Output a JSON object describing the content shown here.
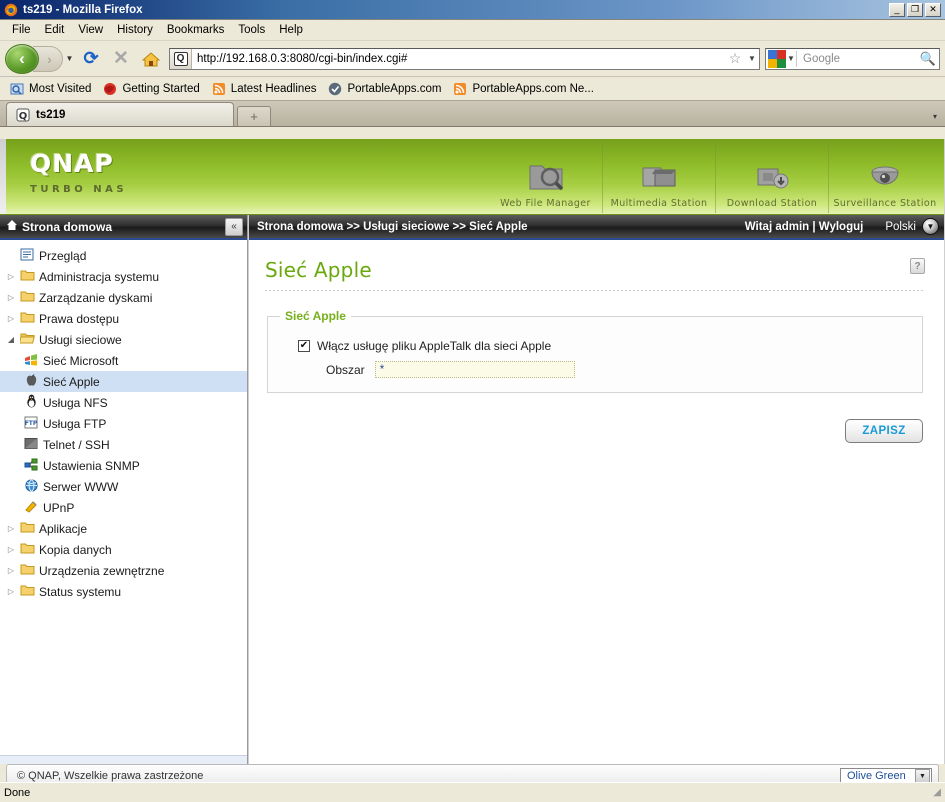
{
  "window": {
    "title": "ts219 - Mozilla Firefox",
    "icon": "firefox-icon",
    "minimize": "_",
    "maximize": "❐",
    "close": "✕"
  },
  "menubar": {
    "items": [
      {
        "label": "File"
      },
      {
        "label": "Edit"
      },
      {
        "label": "View"
      },
      {
        "label": "History"
      },
      {
        "label": "Bookmarks"
      },
      {
        "label": "Tools"
      },
      {
        "label": "Help"
      }
    ]
  },
  "toolbar": {
    "back": "‹",
    "forward": "›",
    "history_caret": "▼",
    "reload": "⟳",
    "stop": "✕",
    "home": "home-icon",
    "url": "http://192.168.0.3:8080/cgi-bin/index.cgi#",
    "url_favicon": "Q",
    "bookmark_star": "☆",
    "url_caret": "▼",
    "search_placeholder": "Google",
    "search_engine": "google-icon",
    "search_caret": "▼",
    "search_magnifier": "🔍"
  },
  "bookmarks": {
    "items": [
      {
        "label": "Most Visited",
        "icon": "most-visited-icon"
      },
      {
        "label": "Getting Started",
        "icon": "firefox-icon"
      },
      {
        "label": "Latest Headlines",
        "icon": "rss-icon"
      },
      {
        "label": "PortableApps.com",
        "icon": "portableapps-icon"
      },
      {
        "label": "PortableApps.com Ne...",
        "icon": "rss-icon"
      }
    ]
  },
  "tabs": {
    "active": {
      "label": "ts219",
      "icon": "qnap-favicon"
    },
    "new_tab": "+",
    "list_all": "▾"
  },
  "banner": {
    "brand": "QNAP",
    "tagline": "TURBO NAS",
    "stations": [
      {
        "label": "Web File Manager",
        "icon": "folder-search-icon"
      },
      {
        "label": "Multimedia Station",
        "icon": "clapperboard-icon"
      },
      {
        "label": "Download Station",
        "icon": "download-box-icon"
      },
      {
        "label": "Surveillance Station",
        "icon": "dome-camera-icon"
      }
    ]
  },
  "sidebar": {
    "header": {
      "title": "Strona domowa",
      "icon": "home-icon",
      "collapse": "«"
    },
    "items": [
      {
        "label": "Przegląd",
        "icon": "overview-icon",
        "level": 1,
        "arrow": "",
        "selected": false
      },
      {
        "label": "Administracja systemu",
        "icon": "folder-icon",
        "level": 1,
        "arrow": "▷",
        "selected": false
      },
      {
        "label": "Zarządzanie dyskami",
        "icon": "folder-icon",
        "level": 1,
        "arrow": "▷",
        "selected": false
      },
      {
        "label": "Prawa dostępu",
        "icon": "folder-icon",
        "level": 1,
        "arrow": "▷",
        "selected": false
      },
      {
        "label": "Usługi sieciowe",
        "icon": "folder-open-icon",
        "level": 1,
        "arrow": "◢",
        "selected": false
      },
      {
        "label": "Sieć Microsoft",
        "icon": "windows-icon",
        "level": 2,
        "arrow": "",
        "selected": false
      },
      {
        "label": "Sieć Apple",
        "icon": "apple-icon",
        "level": 2,
        "arrow": "",
        "selected": true
      },
      {
        "label": "Usługa NFS",
        "icon": "linux-penguin-icon",
        "level": 2,
        "arrow": "",
        "selected": false
      },
      {
        "label": "Usługa FTP",
        "icon": "ftp-icon",
        "level": 2,
        "arrow": "",
        "selected": false
      },
      {
        "label": "Telnet / SSH",
        "icon": "terminal-icon",
        "level": 2,
        "arrow": "",
        "selected": false
      },
      {
        "label": "Ustawienia SNMP",
        "icon": "snmp-network-icon",
        "level": 2,
        "arrow": "",
        "selected": false
      },
      {
        "label": "Serwer WWW",
        "icon": "globe-icon",
        "level": 2,
        "arrow": "",
        "selected": false
      },
      {
        "label": "UPnP",
        "icon": "upnp-icon",
        "level": 2,
        "arrow": "",
        "selected": false
      },
      {
        "label": "Aplikacje",
        "icon": "folder-icon",
        "level": 1,
        "arrow": "▷",
        "selected": false
      },
      {
        "label": "Kopia danych",
        "icon": "folder-icon",
        "level": 1,
        "arrow": "▷",
        "selected": false
      },
      {
        "label": "Urządzenia zewnętrzne",
        "icon": "folder-icon",
        "level": 1,
        "arrow": "▷",
        "selected": false
      },
      {
        "label": "Status systemu",
        "icon": "folder-icon",
        "level": 1,
        "arrow": "▷",
        "selected": false
      }
    ]
  },
  "breadcrumb": {
    "text": "Strona domowa >> Usługi sieciowe >> Sieć Apple",
    "welcome": "Witaj admin | Wyloguj",
    "language": "Polski",
    "language_caret": "▼"
  },
  "main": {
    "title": "Sieć Apple",
    "help": "?",
    "fieldset_legend": "Sieć Apple",
    "checkbox": {
      "label": "Włącz usługę pliku AppleTalk dla sieci Apple",
      "checked": true,
      "mark": "✔"
    },
    "field": {
      "label": "Obszar",
      "value": "*"
    },
    "save_label": "ZAPISZ"
  },
  "footer": {
    "copyright": "© QNAP, Wszelkie prawa zastrzeżone",
    "theme": "Olive Green",
    "theme_caret": "▼"
  },
  "statusbar": {
    "text": "Done",
    "grip": "◢"
  },
  "colors": {
    "brand_green": "#8fbd2a",
    "title_green": "#6aa80d",
    "legend_green": "#76b01b",
    "save_blue": "#1a9ad6",
    "selection_blue": "#cfe0f4",
    "titlebar_blue": "#0a246a"
  }
}
